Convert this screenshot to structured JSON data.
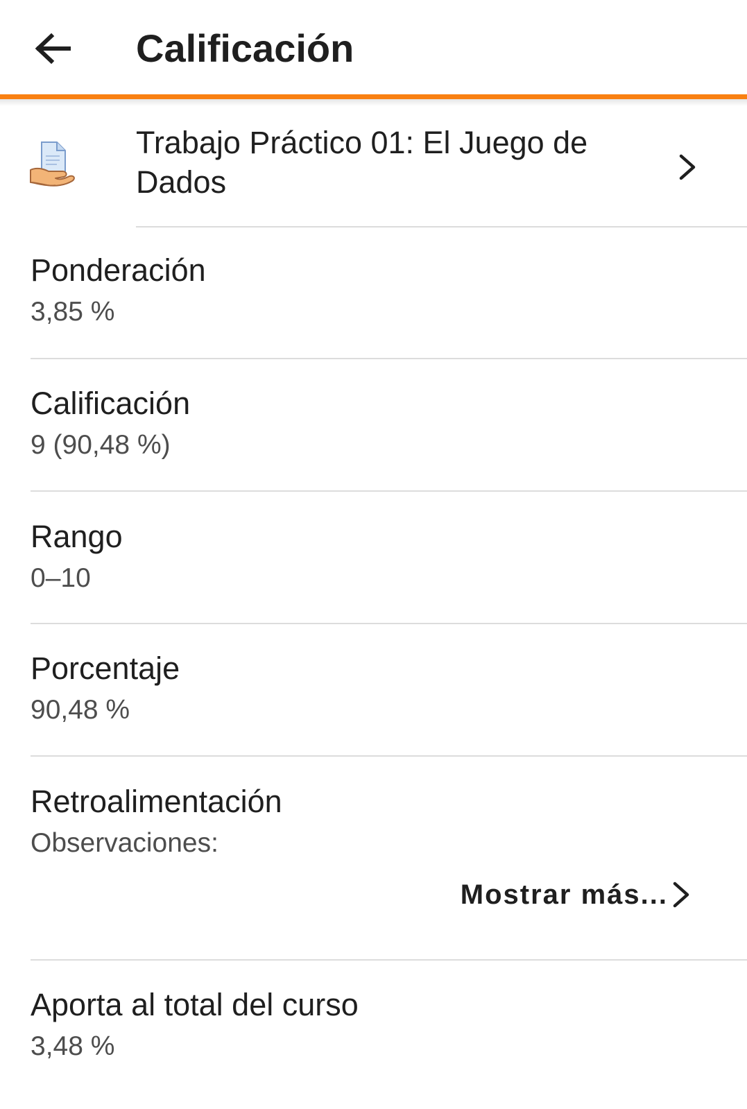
{
  "header": {
    "title": "Calificación",
    "back_icon": "arrow-left-icon",
    "accent_color": "#f98012"
  },
  "activity": {
    "icon": "assignment-icon",
    "title": "Trabajo Práctico 01: El Juego de Dados",
    "chevron_icon": "chevron-right-icon"
  },
  "items": [
    {
      "label": "Ponderación",
      "value": "3,85 %"
    },
    {
      "label": "Calificación",
      "value": "9 (90,48 %)"
    },
    {
      "label": "Rango",
      "value": "0–10"
    },
    {
      "label": "Porcentaje",
      "value": "90,48 %"
    },
    {
      "label": "Retroalimentación",
      "value": "Observaciones:"
    },
    {
      "label": "Aporta al total del curso",
      "value": "3,48 %"
    }
  ],
  "feedback": {
    "show_more_label": "Mostrar más...",
    "chevron_icon": "chevron-right-icon"
  }
}
